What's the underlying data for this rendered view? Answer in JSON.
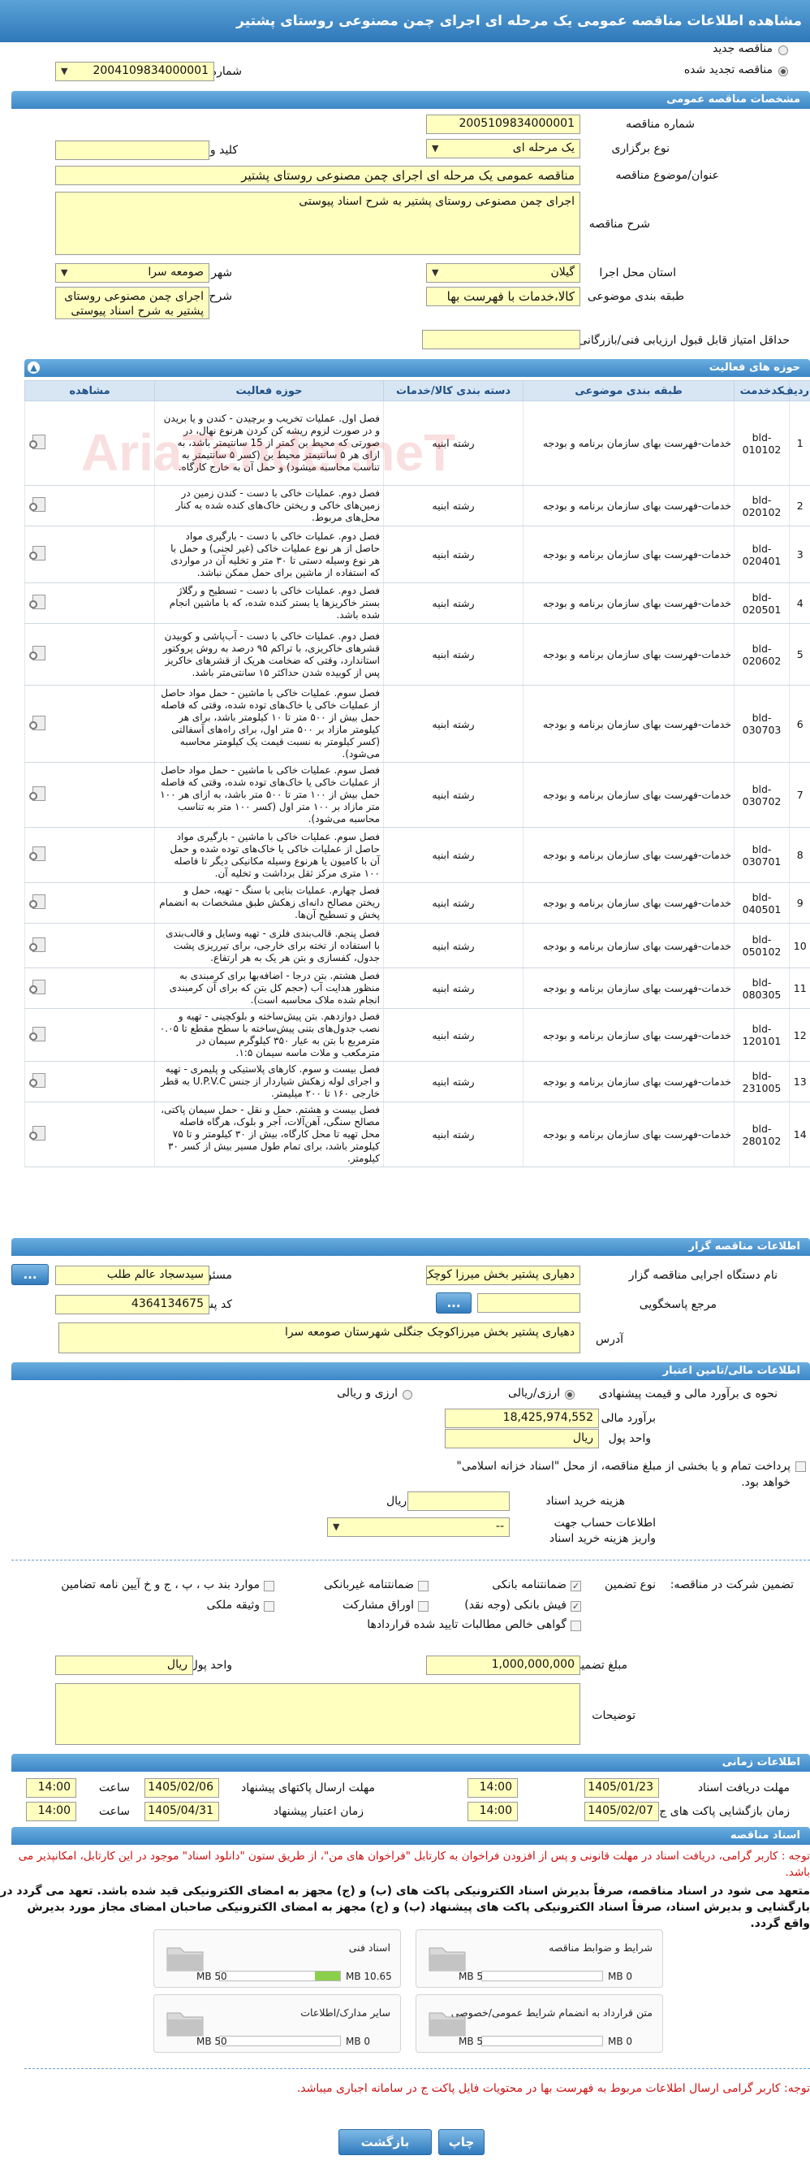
{
  "title": "مشاهده اطلاعات مناقصه عمومی یک مرحله ای اجرای چمن مصنوعی روستای پشتیر",
  "top": {
    "radio_new": "مناقصه جدید",
    "radio_renewed": "مناقصه تجدید شده",
    "prev_label": "شماره مناقصه قبلی",
    "prev_value": "2004109834000001"
  },
  "general": {
    "header": "مشخصات مناقصه عمومی",
    "number_label": "شماره مناقصه",
    "number": "2005109834000001",
    "type_label": "نوع برگزاری",
    "type": "یک مرحله ای",
    "keyword_label": "کلید واژه",
    "keyword": "",
    "subject_label": "عنوان/موضوع مناقصه",
    "subject": "مناقصه عمومی یک مرحله ای اجرای چمن مصنوعی روستای پشتیر",
    "desc_label": "شرح مناقصه",
    "desc": "اجرای چمن مصنوعی روستای پشتیر به شرح اسناد پیوستی",
    "province_label": "استان محل اجرا",
    "province": "گیلان",
    "city_label": "شهر محل اجرا",
    "city": "صومعه سرا",
    "category_label": "طبقه بندی موضوعی",
    "category": "کالا،خدمات با فهرست بها",
    "scope_label": "شرح کلی حوزه فعالیت",
    "scope": "اجرای چمن مصنوعی روستای پشتیر به شرح اسناد پیوستی",
    "minscore_label": "حداقل امتیاز قابل قبول ارزیابی فنی/بازرگانی",
    "minscore": ""
  },
  "activities": {
    "header": "حوزه های فعالیت",
    "columns": [
      "ردیف",
      "کدخدمت",
      "طبقه بندی موضوعی",
      "دسته بندی کالا/خدمات",
      "حوزه فعالیت",
      "مشاهده"
    ],
    "rows": [
      {
        "n": "1",
        "code": "bld-010102",
        "cat": "خدمات-فهرست بهای سازمان برنامه و بودجه",
        "group": "رشته ابنیه",
        "desc": "فصل اول. عملیات تخریب و برچیدن - کندن و یا بریدن و در صورت لزوم ریشه کن کردن هرنوع نهال، در صورتی که محیط بن کمتر از 15 سانتیمتر باشد، به ازای هر ۵ سانتیمتر محیط بن (کسر ۵ سانتیمتر به تناسب محاسبه میشود) و حمل آن به خارج کارگاه."
      },
      {
        "n": "2",
        "code": "bld-020102",
        "cat": "خدمات-فهرست بهای سازمان برنامه و بودجه",
        "group": "رشته ابنیه",
        "desc": "فصل دوم. عملیات خاکی با دست - کندن زمین در زمین‌های خاکی و ریختن خاک‌های کنده شده به کنار محل‌های مربوط."
      },
      {
        "n": "3",
        "code": "bld-020401",
        "cat": "خدمات-فهرست بهای سازمان برنامه و بودجه",
        "group": "رشته ابنیه",
        "desc": "فصل دوم. عملیات خاکی با دست - بارگیری مواد حاصل از هر نوع عملیات خاکی (غیر لجنی) و حمل با هر نوع وسیله دستی تا ۳۰ متر و تخلیه آن در مواردی که استفاده از ماشین برای حمل ممکن نباشد."
      },
      {
        "n": "4",
        "code": "bld-020501",
        "cat": "خدمات-فهرست بهای سازمان برنامه و بودجه",
        "group": "رشته ابنیه",
        "desc": "فصل دوم. عملیات خاکی با دست - تسطیح و رگلاژ بستر خاکریزها یا بستر کنده شده، که با ماشین انجام شده باشد."
      },
      {
        "n": "5",
        "code": "bld-020602",
        "cat": "خدمات-فهرست بهای سازمان برنامه و بودجه",
        "group": "رشته ابنیه",
        "desc": "فصل دوم. عملیات خاکی با دست - آب‌پاشی و کوبیدن قشرهای خاکریزی، با تراکم ۹۵ درصد به روش پروکتور استاندارد، وقتی که ضخامت هریک از قشرهای خاکریز پس از کوبیده شدن حداکثر ۱۵ سانتی‌متر باشد."
      },
      {
        "n": "6",
        "code": "bld-030703",
        "cat": "خدمات-فهرست بهای سازمان برنامه و بودجه",
        "group": "رشته ابنیه",
        "desc": "فصل سوم. عملیات خاکی با ماشین - حمل مواد حاصل از عملیات خاکی یا خاک‌های توده شده، وقتی که فاصله حمل بیش از ۵۰۰ متر تا ۱۰ کیلومتر باشد، برای هر کیلومتر مازاد بر ۵۰۰ متر اول، برای راه‌های آسفالتی (کسر کیلومتر به نسبت قیمت یک کیلومتر محاسبه می‌شود)."
      },
      {
        "n": "7",
        "code": "bld-030702",
        "cat": "خدمات-فهرست بهای سازمان برنامه و بودجه",
        "group": "رشته ابنیه",
        "desc": "فصل سوم. عملیات خاکی با ماشین - حمل مواد حاصل از عملیات خاکی یا خاک‌های توده شده، وقتی که فاصله حمل بیش از ۱۰۰ متر تا ۵۰۰ متر باشد، به ازای هر ۱۰۰ متر مازاد بر ۱۰۰ متر اول (کسر ۱۰۰ متر به تناسب محاسبه می‌شود)."
      },
      {
        "n": "8",
        "code": "bld-030701",
        "cat": "خدمات-فهرست بهای سازمان برنامه و بودجه",
        "group": "رشته ابنیه",
        "desc": "فصل سوم. عملیات خاکی با ماشین - بارگیری مواد حاصل از عملیات خاکی یا خاک‌های توده شده و حمل آن با کامیون یا هرنوع وسیله مکانیکی دیگر تا فاصله ۱۰۰ متری مرکز ثقل برداشت و تخلیه آن."
      },
      {
        "n": "9",
        "code": "bld-040501",
        "cat": "خدمات-فهرست بهای سازمان برنامه و بودجه",
        "group": "رشته ابنیه",
        "desc": "فصل چهارم. عملیات بنایی با سنگ - تهیه، حمل و ریختن مصالح دانه‌ای زهکش طبق مشخصات به انضمام پخش و تسطیح آن‌ها."
      },
      {
        "n": "10",
        "code": "bld-050102",
        "cat": "خدمات-فهرست بهای سازمان برنامه و بودجه",
        "group": "رشته ابنیه",
        "desc": "فصل پنجم. قالب‌بندی فلزی - تهیه وسایل و قالب‌بندی با استفاده از تخته برای خارجی، برای تیرریزی پشت جدول، کفسازی و بتن هر یک به هر ارتفاع."
      },
      {
        "n": "11",
        "code": "bld-080305",
        "cat": "خدمات-فهرست بهای سازمان برنامه و بودجه",
        "group": "رشته ابنیه",
        "desc": "فصل هشتم. بتن درجا - اضافه‌بها برای کرمبندی به منظور هدایت آب (حجم کل بتن که برای آن کرمبندی انجام شده ملاک محاسبه است)."
      },
      {
        "n": "12",
        "code": "bld-120101",
        "cat": "خدمات-فهرست بهای سازمان برنامه و بودجه",
        "group": "رشته ابنیه",
        "desc": "فصل دوازدهم. بتن پیش‌ساخته و بلوکچینی - تهیه و نصب جدول‌های بتنی پیش‌ساخته با سطح مقطع تا ۰.۰۵ مترمربع با بتن به عیار ۳۵۰ کیلوگرم سیمان در مترمکعب و ملات ماسه سیمان ۱:۵."
      },
      {
        "n": "13",
        "code": "bld-231005",
        "cat": "خدمات-فهرست بهای سازمان برنامه و بودجه",
        "group": "رشته ابنیه",
        "desc": "فصل بیست و سوم. کارهای پلاستیکی و پلیمری - تهیه و اجرای لوله زهکش شیاردار از جنس U.P.V.C به قطر خارجی ۱۶۰ تا ۲۰۰ میلیمتر."
      },
      {
        "n": "14",
        "code": "bld-280102",
        "cat": "خدمات-فهرست بهای سازمان برنامه و بودجه",
        "group": "رشته ابنیه",
        "desc": "فصل بیست و هشتم. حمل و نقل - حمل سیمان پاکتی، مصالح سنگی، آهن‌آلات، آجر و بلوک، هرگاه فاصله محل تهیه تا محل کارگاه، بیش از ۳۰ کیلومتر و تا ۷۵ کیلومتر باشد، برای تمام طول مسیر بیش از کسر ۳۰ کیلومتر."
      }
    ]
  },
  "organizer": {
    "header": "اطلاعات مناقصه گزار",
    "org_label": "نام دستگاه اجرایی مناقصه گزار",
    "org": "دهیاری پشتیر بخش میرزا کوچک جنگلی",
    "responsible_label": "مسئول ثبت مناقصه",
    "responsible": "سیدسجاد عالم طلب",
    "ref_label": "مرجع پاسخگویی",
    "ref": "",
    "postal_label": "کد پستی",
    "postal": "4364134675",
    "address_label": "آدرس",
    "address": "دهیاری پشتیر بخش میرزاکوچک جنگلی شهرستان صومعه سرا",
    "dots_button": "..."
  },
  "financial": {
    "header": "اطلاعات مالی/تامین اعتبار",
    "estimate_type_label": "نحوه ی برآورد مالی و قیمت پیشنهادی",
    "opt_rial": "ارزی/ریالی",
    "opt_foreign": "ارزی و ریالی",
    "estimate_label": "برآورد مالی",
    "estimate": "18,425,974,552",
    "unit_label": "واحد پول",
    "unit": "ریال",
    "treasury_text": "پرداخت تمام و یا بخشی از مبلغ مناقصه، از محل \"اسناد خزانه اسلامی\" خواهد بود.",
    "doc_cost_label": "هزینه خرید اسناد",
    "doc_cost": "",
    "doc_cost_unit": "ریال",
    "account_label": "اطلاعات حساب جهت واریز هزینه خرید اسناد",
    "account_value": "--"
  },
  "guarantee": {
    "section_label": "تضمین شرکت در مناقصه:",
    "type_label": "نوع تضمین",
    "options": [
      {
        "label": "ضمانتنامه بانکی",
        "checked": true
      },
      {
        "label": "ضمانتنامه غیربانکی",
        "checked": false
      },
      {
        "label": "موارد بند ب ، پ ، ج و خ آیین نامه تضامین",
        "checked": false
      },
      {
        "label": "فیش بانکی (وجه نقد)",
        "checked": true
      },
      {
        "label": "اوراق مشارکت",
        "checked": false
      },
      {
        "label": "وثیقه ملکی",
        "checked": false
      },
      {
        "label": "گواهی خالص مطالبات تایید شده قراردادها",
        "checked": false
      }
    ],
    "amount_label": "مبلغ تضمین",
    "amount": "1,000,000,000",
    "unit_label": "واحد پول",
    "unit": "ریال",
    "notes_label": "توضیحات",
    "notes": ""
  },
  "timing": {
    "header": "اطلاعات زمانی",
    "receive_label": "مهلت دریافت اسناد",
    "receive_date": "1405/01/23",
    "receive_time": "14:00",
    "send_label": "مهلت ارسال پاکتهای پیشنهاد",
    "send_date": "1405/02/06",
    "send_time": "14:00",
    "open_label": "زمان بازگشایی پاکت های ج",
    "open_date": "1405/02/07",
    "open_time": "14:00",
    "validity_label": "زمان اعتبار پیشنهاد",
    "validity_date": "1405/04/31",
    "validity_time": "14:00",
    "time_label": "ساعت"
  },
  "documents": {
    "header": "اسناد مناقصه",
    "note1": "توجه : کاربر گرامی، دریافت اسناد در مهلت قانونی و پس از افزودن فراخوان به کارتابل \"فراخوان های من\"، از طریق ستون \"دانلود اسناد\" موجود در این کارتابل، امکانپذیر می باشد.",
    "note2": "متعهد می شود در اسناد مناقصه، صرفاً بدیرش اسناد الکترونیکی پاکت های (ب) و (ج) مجهز به امضای الکترونیکی قید شده باشد. تعهد می گردد در بارگشایی و بدیرش اسناد، صرفاً اسناد الکترونیکی پاکت های پیشنهاد (ب) و (ج) مجهز به امضای الکترونیکی صاحبان امضای مجاز مورد بدیرش واقع گردد.",
    "cards": [
      {
        "name": "شرایط و ضوابط مناقصه",
        "current": "0 MB",
        "max": "5 MB",
        "fill": 0
      },
      {
        "name": "اسناد فنی",
        "current": "10.65 MB",
        "max": "50 MB",
        "fill": 0.21
      },
      {
        "name": "متن قرارداد به انضمام شرایط عمومی/خصوصی",
        "current": "0 MB",
        "max": "5 MB",
        "fill": 0
      },
      {
        "name": "سایر مدارک/اطلاعات",
        "current": "0 MB",
        "max": "50 MB",
        "fill": 0
      }
    ],
    "note3": "توجه: کاربر گرامی ارسال اطلاعات مربوط به فهرست بها در محتویات فایل پاکت ج در سامانه اجباری میباشد."
  },
  "buttons": {
    "print": "چاپ",
    "back": "بازگشت"
  },
  "watermark": "AriaTender.neT"
}
